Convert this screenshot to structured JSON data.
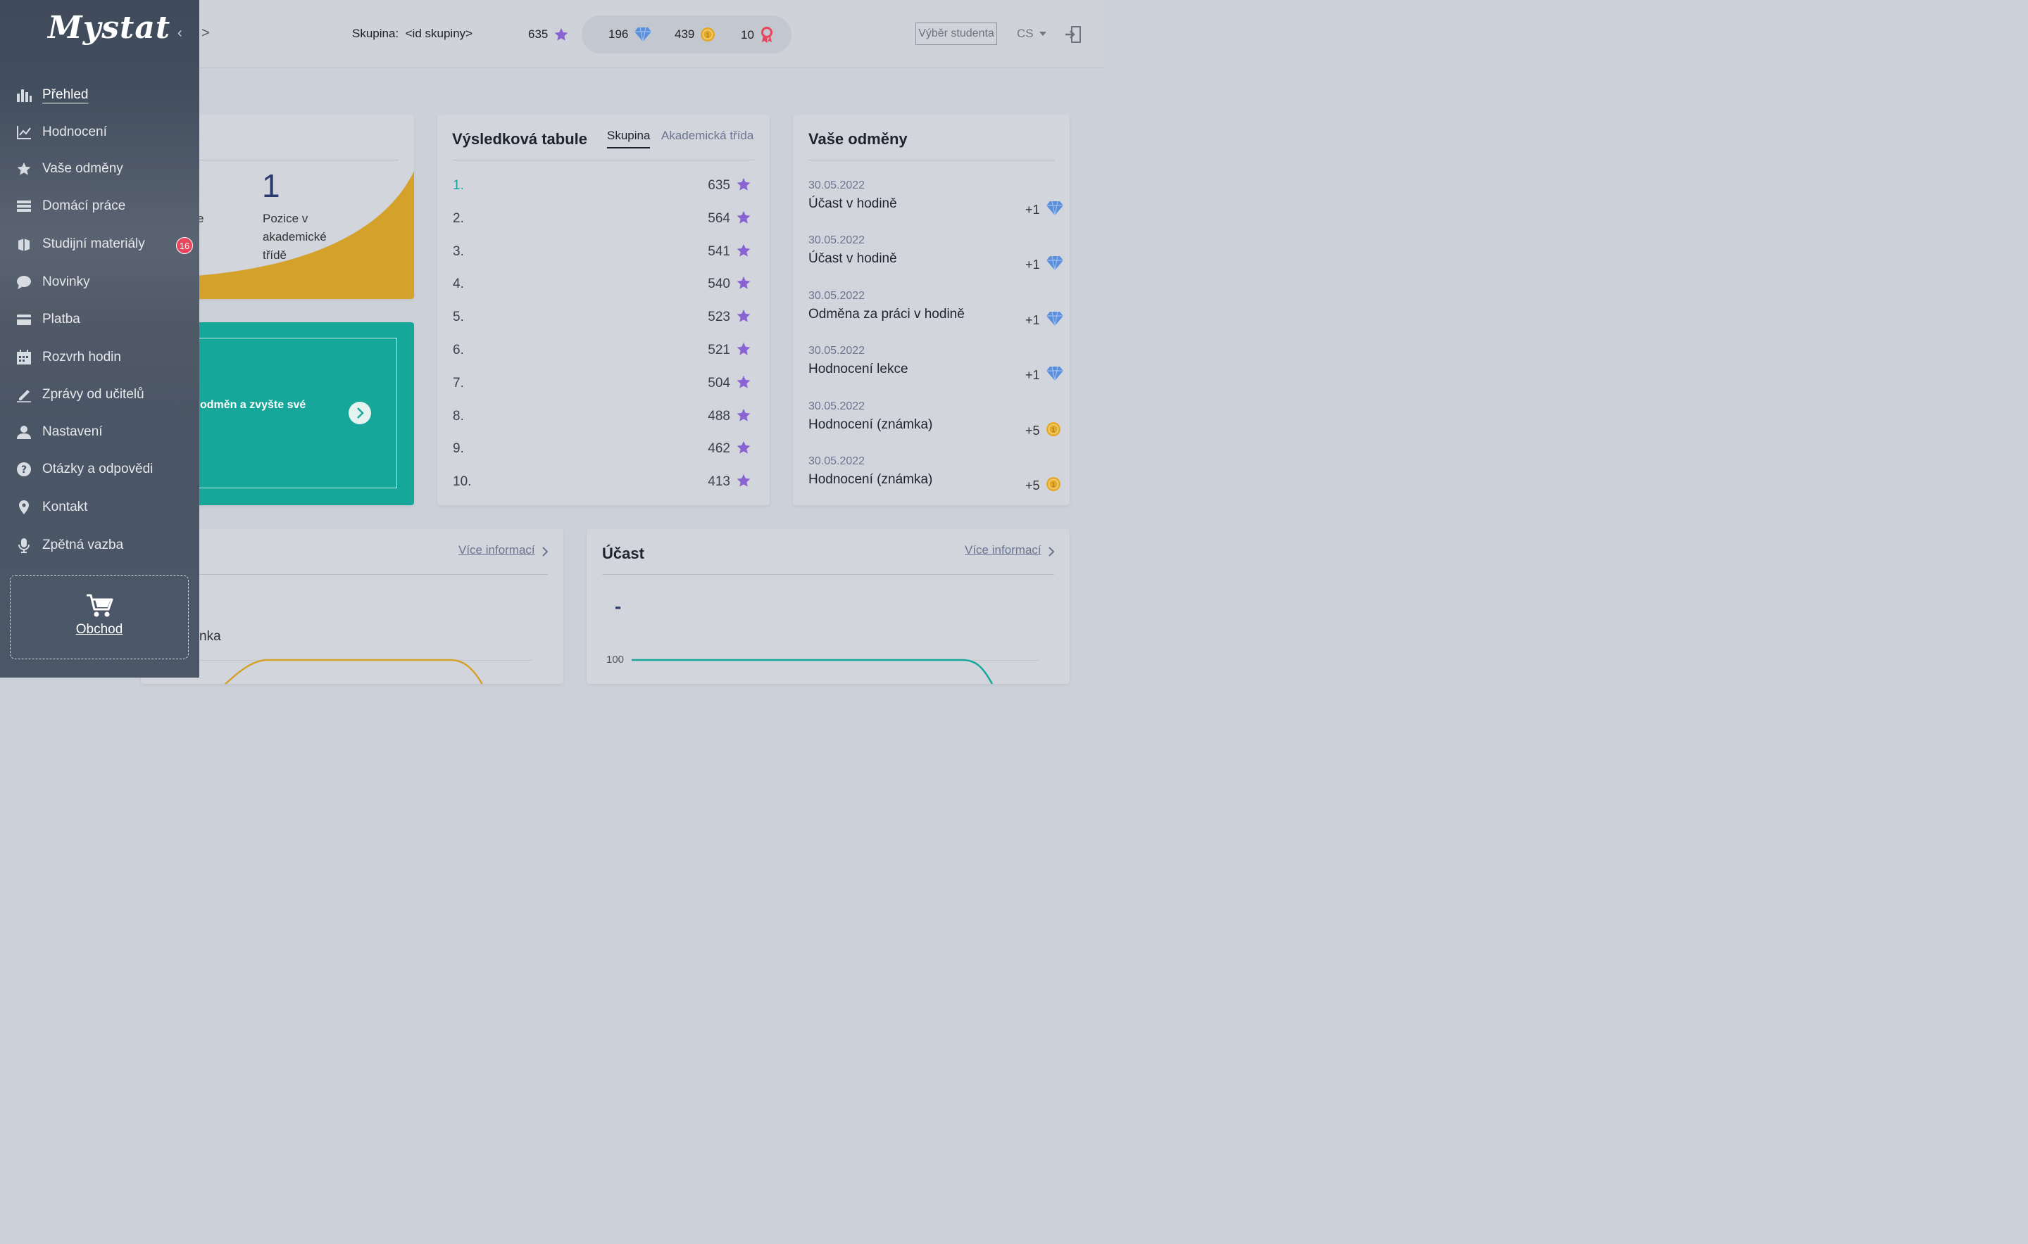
{
  "app": {
    "logo": "Mystat"
  },
  "header": {
    "expand_arrow": ">",
    "group_label": "Skupina:",
    "group_value": "<id skupiny>",
    "stats": {
      "stars": "635",
      "diamonds": "196",
      "coins": "439",
      "badges": "10"
    },
    "select_student": "Výběr studenta",
    "language": "CS"
  },
  "sidebar": {
    "items": [
      {
        "label": "Přehled",
        "icon": "bar-chart-icon"
      },
      {
        "label": "Hodnocení",
        "icon": "line-chart-icon"
      },
      {
        "label": "Vaše odměny",
        "icon": "star-icon"
      },
      {
        "label": "Domácí práce",
        "icon": "tray-icon"
      },
      {
        "label": "Studijní materiály",
        "icon": "books-icon"
      },
      {
        "label": "Novinky",
        "icon": "chat-icon"
      },
      {
        "label": "Platba",
        "icon": "card-icon"
      },
      {
        "label": "Rozvrh hodin",
        "icon": "calendar-icon"
      },
      {
        "label": "Zprávy od učitelů",
        "icon": "pen-icon"
      },
      {
        "label": "Nastavení",
        "icon": "user-icon"
      },
      {
        "label": "Otázky a odpovědi",
        "icon": "question-icon"
      },
      {
        "label": "Kontakt",
        "icon": "pin-icon"
      },
      {
        "label": "Zpětná vazba",
        "icon": "mic-icon"
      }
    ],
    "materials_badge": "16",
    "shop_label": "Obchod"
  },
  "position_card": {
    "partial_label": "e",
    "rank": "1",
    "rank_caption_1": "Pozice v",
    "rank_caption_2": "akademické",
    "rank_caption_3": "třídě"
  },
  "promo_card": {
    "text": "odměn a zvyšte své"
  },
  "leaderboard": {
    "title": "Výsledková tabule",
    "tabs": [
      "Skupina",
      "Akademická třída"
    ],
    "rows": [
      {
        "rank": "1.",
        "points": "635"
      },
      {
        "rank": "2.",
        "points": "564"
      },
      {
        "rank": "3.",
        "points": "541"
      },
      {
        "rank": "4.",
        "points": "540"
      },
      {
        "rank": "5.",
        "points": "523"
      },
      {
        "rank": "6.",
        "points": "521"
      },
      {
        "rank": "7.",
        "points": "504"
      },
      {
        "rank": "8.",
        "points": "488"
      },
      {
        "rank": "9.",
        "points": "462"
      },
      {
        "rank": "10.",
        "points": "413"
      }
    ]
  },
  "rewards": {
    "title": "Vaše odměny",
    "items": [
      {
        "date": "30.05.2022",
        "name": "Účast v hodině",
        "amount": "+1",
        "icon": "diamond-icon"
      },
      {
        "date": "30.05.2022",
        "name": "Účast v hodině",
        "amount": "+1",
        "icon": "diamond-icon"
      },
      {
        "date": "30.05.2022",
        "name": "Odměna za práci v hodině",
        "amount": "+1",
        "icon": "diamond-icon"
      },
      {
        "date": "30.05.2022",
        "name": "Hodnocení lekce",
        "amount": "+1",
        "icon": "diamond-icon"
      },
      {
        "date": "30.05.2022",
        "name": "Hodnocení (známka)",
        "amount": "+5",
        "icon": "coin-icon"
      },
      {
        "date": "30.05.2022",
        "name": "Hodnocení (známka)",
        "amount": "+5",
        "icon": "coin-icon"
      }
    ]
  },
  "grades_card": {
    "more_link": "Více informací",
    "partial_label": "nka"
  },
  "attendance_card": {
    "title": "Účast",
    "more_link": "Více informací",
    "value": "-",
    "axis_tick": "100"
  },
  "colors": {
    "sidebar": "#4a5565",
    "teal": "#17a79a",
    "gold": "#d4a22b",
    "star": "#8a63d2",
    "diamond": "#5b8fdb",
    "coin": "#e3a92a",
    "badge": "#e8465c"
  }
}
